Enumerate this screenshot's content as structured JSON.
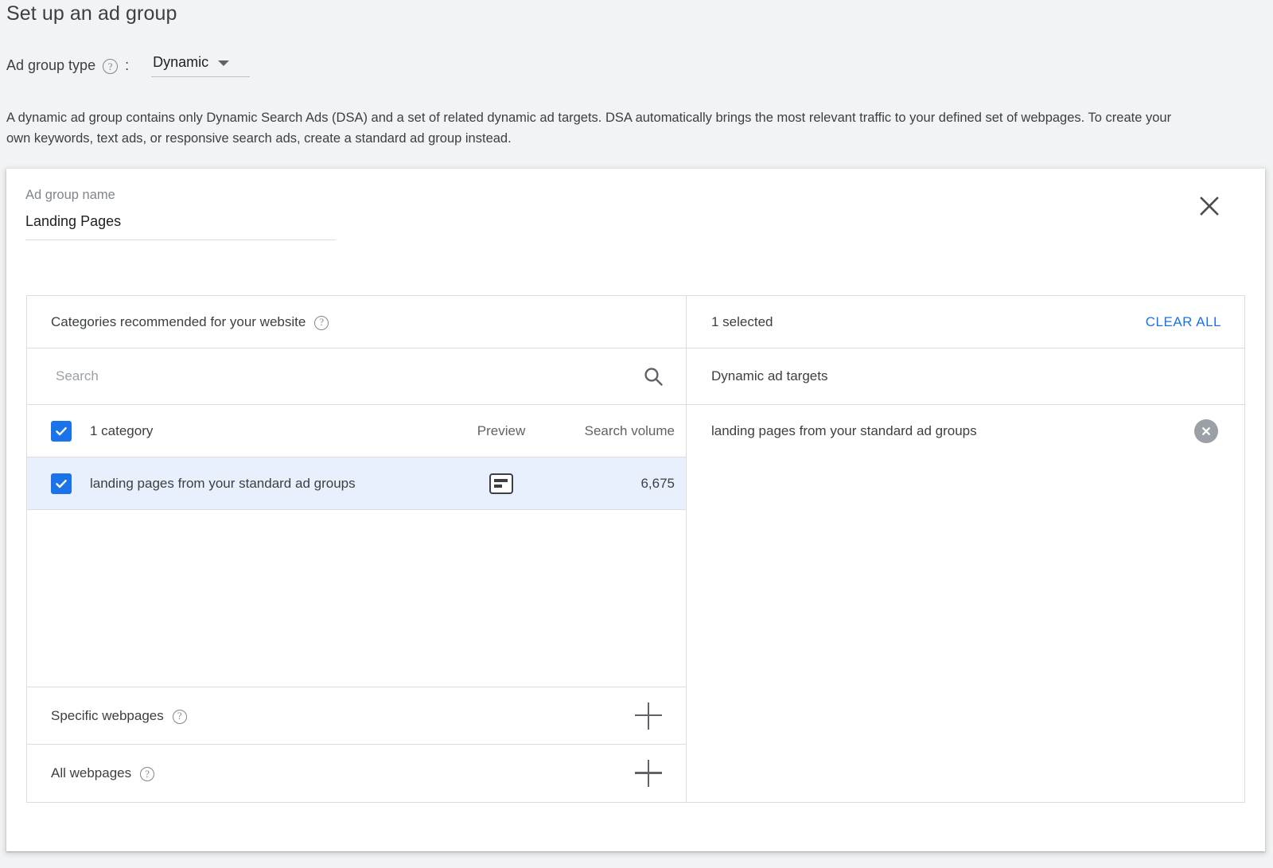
{
  "header": {
    "title": "Set up an ad group",
    "ad_group_type_label": "Ad group type",
    "help_icon_glyph": "?",
    "colon": ":",
    "ad_group_type_value": "Dynamic",
    "description": "A dynamic ad group contains only Dynamic Search Ads (DSA) and a set of related dynamic ad targets. DSA automatically brings the most relevant traffic to your defined set of webpages. To create your own keywords, text ads, or responsive search ads, create a standard ad group instead."
  },
  "card": {
    "close_icon": "close-icon",
    "ad_group_name_label": "Ad group name",
    "ad_group_name_value": "Landing Pages"
  },
  "left_panel": {
    "categories_header": "Categories recommended for your website",
    "search_placeholder": "Search",
    "search_value": "",
    "search_icon": "search-icon",
    "table": {
      "header": {
        "select_all_checked": true,
        "label": "1 category",
        "preview_col": "Preview",
        "volume_col": "Search volume"
      },
      "rows": [
        {
          "checked": true,
          "label": "landing pages from your standard ad groups",
          "preview_icon": "webpage-preview-icon",
          "search_volume": "6,675",
          "selected": true
        }
      ]
    },
    "footer_rows": [
      {
        "label": "Specific webpages",
        "action_icon": "plus-icon"
      },
      {
        "label": "All webpages",
        "action_icon": "plus-icon"
      }
    ]
  },
  "right_panel": {
    "selected_count": "1 selected",
    "clear_all_label": "CLEAR ALL",
    "targets_header": "Dynamic ad targets",
    "targets": [
      {
        "label": "landing pages from your standard ad groups",
        "remove_icon": "remove-circle-icon"
      }
    ]
  },
  "colors": {
    "page_background": "#f1f3f4",
    "accent_blue": "#1a73e8",
    "selected_row_background": "#e8f0fe",
    "border": "#dadce0",
    "text_primary": "#3c4043",
    "text_secondary": "#5f6368",
    "placeholder": "#9aa0a6",
    "chip_gray": "#9aa0a6"
  }
}
